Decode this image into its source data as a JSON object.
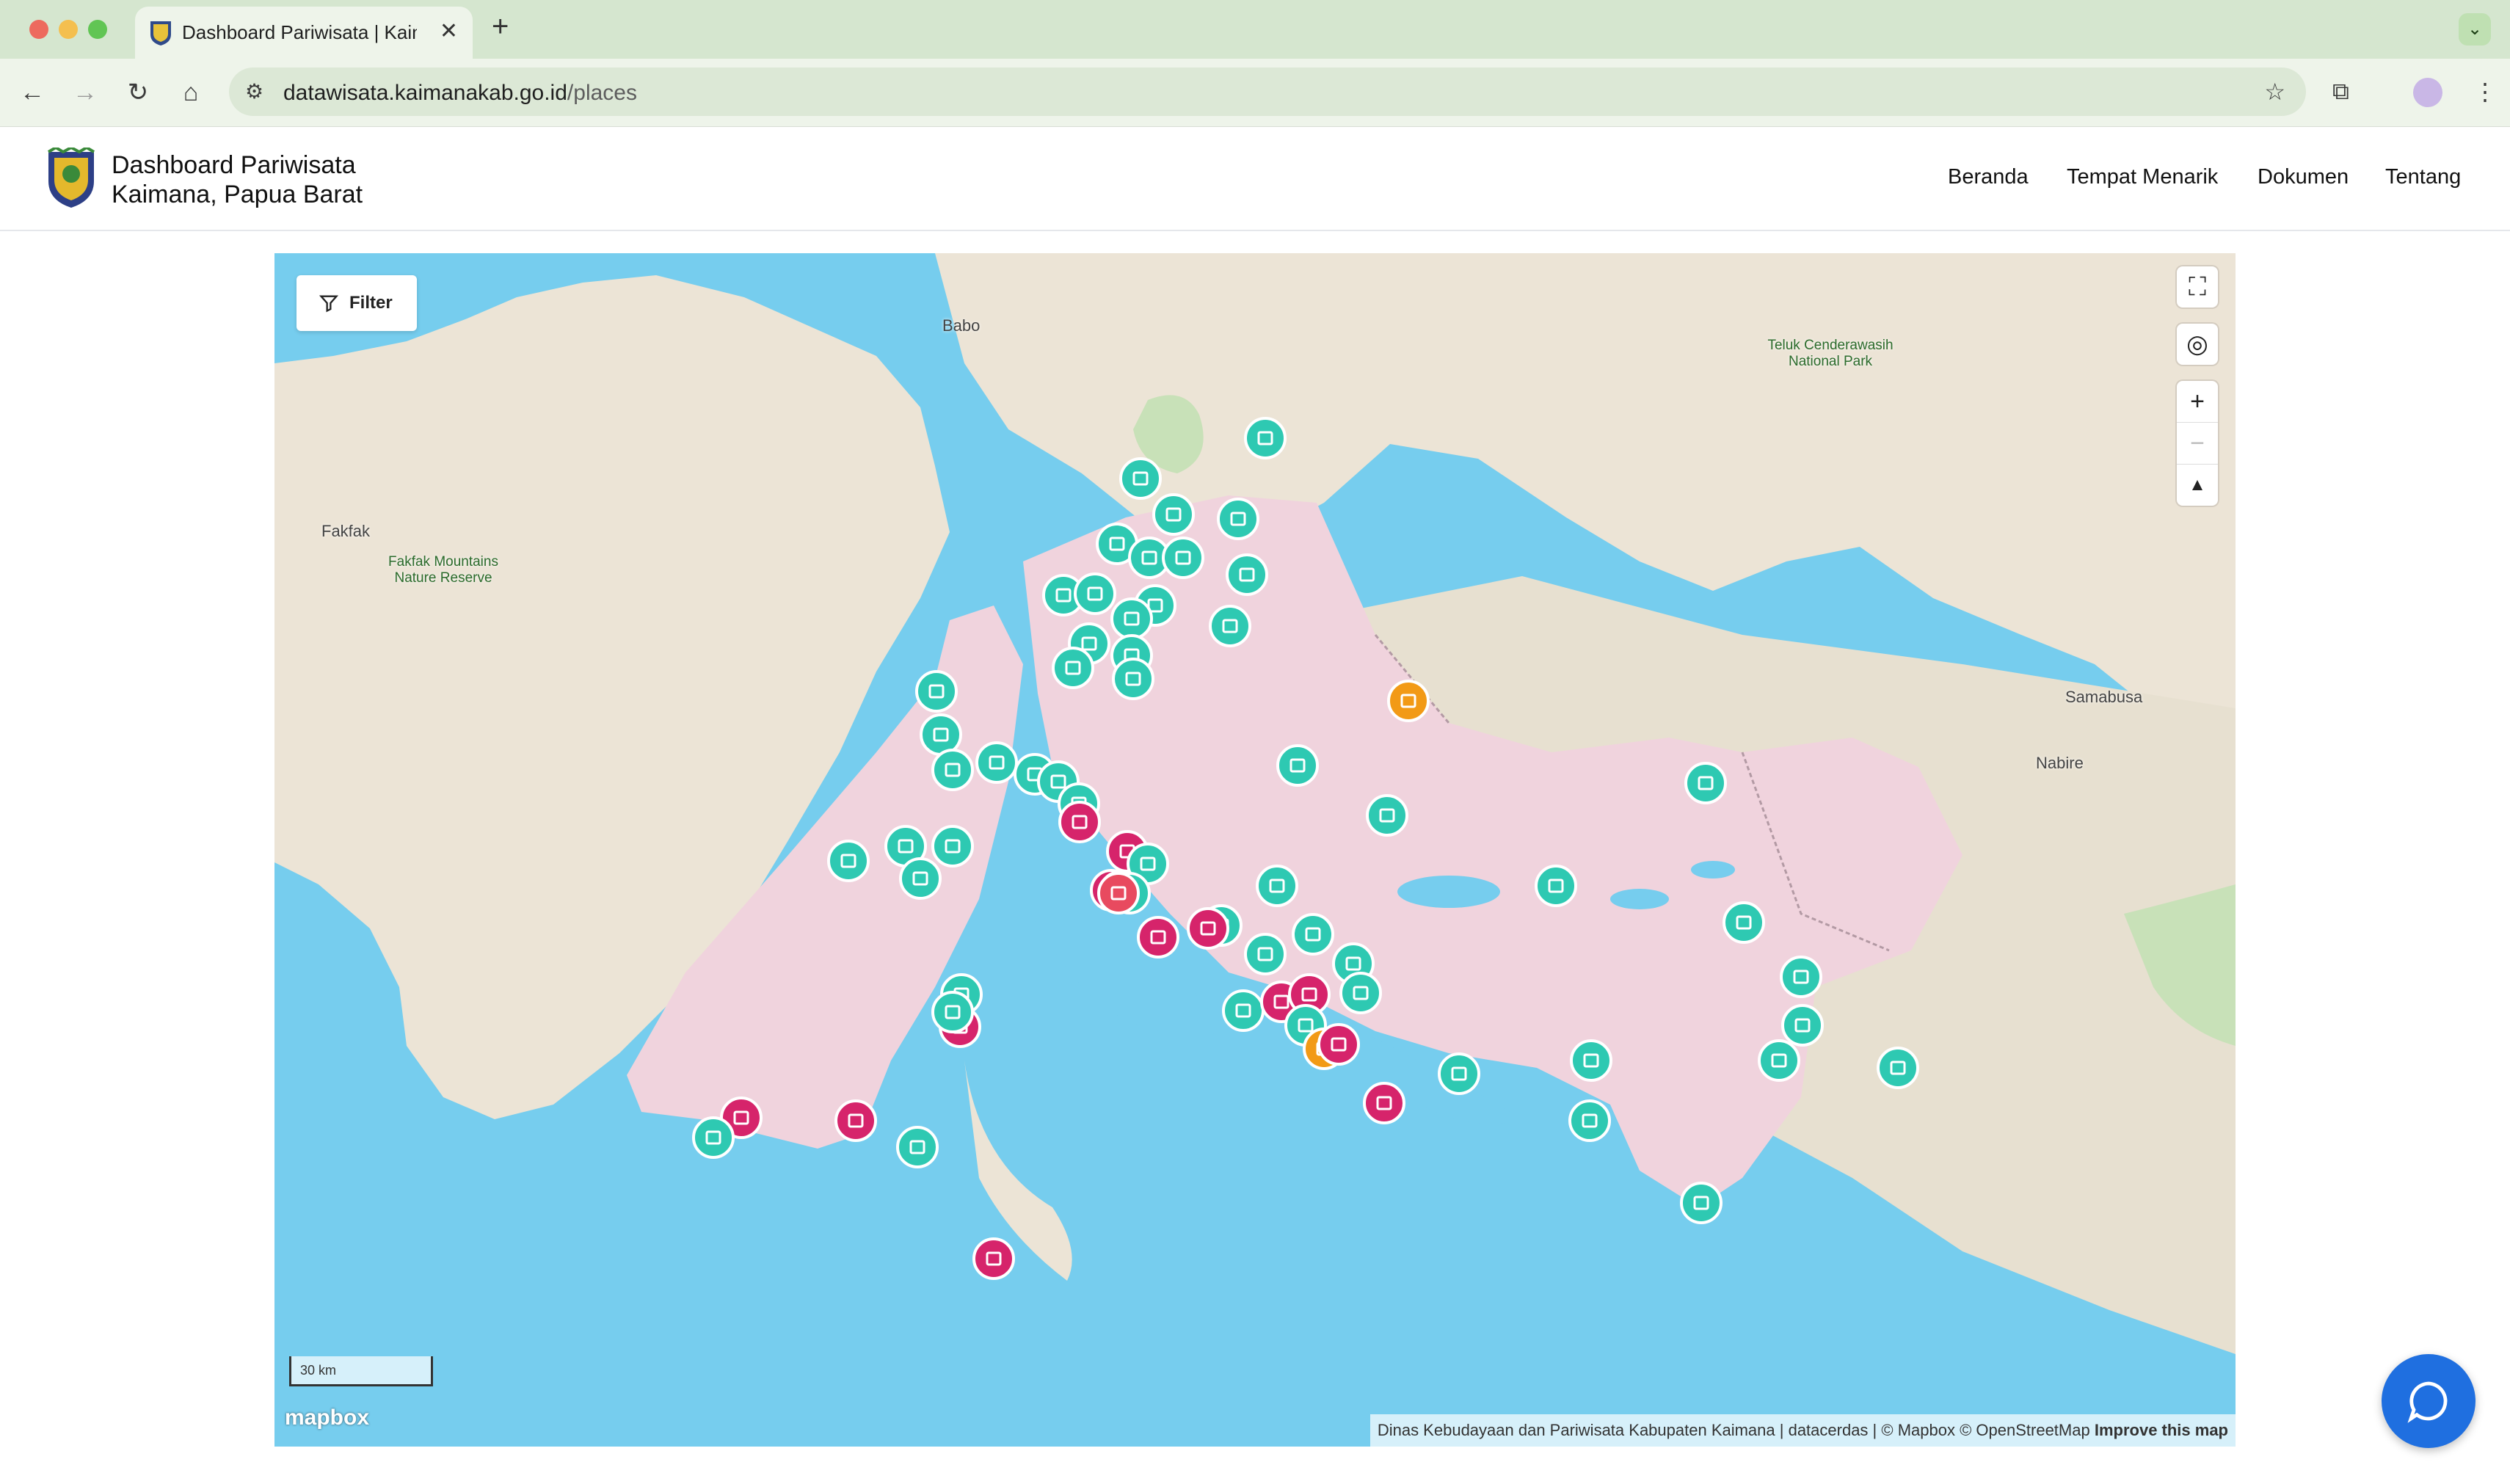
{
  "browser": {
    "tab_title": "Dashboard Pariwisata | Kaimana",
    "url_host": "datawisata.kaimanakab.go.id",
    "url_path": "/places"
  },
  "site": {
    "title_line1": "Dashboard Pariwisata",
    "title_line2": "Kaimana, Papua Barat",
    "nav": [
      "Beranda",
      "Tempat Menarik",
      "Dokumen",
      "Tentang"
    ]
  },
  "map": {
    "filter_label": "Filter",
    "labels": {
      "babo": "Babo",
      "fakfak": "Fakfak",
      "fakfak_park": "Fakfak Mountains Nature Reserve",
      "teluk_park": "Teluk Cenderawasih National Park",
      "samabusa": "Samabusa",
      "nabire": "Nabire"
    },
    "scale_label": "30 km",
    "mapbox_logo": "mapbox",
    "attribution": "Dinas Kebudayaan dan Pariwisata Kabupaten Kaimana | datacerdas | © Mapbox © OpenStreetMap",
    "improve_link": "Improve this map",
    "marker_colors": {
      "village": "#2ec9b2",
      "beach": "#d6246b",
      "culture": "#f29a16",
      "market": "#e84a5f"
    }
  }
}
